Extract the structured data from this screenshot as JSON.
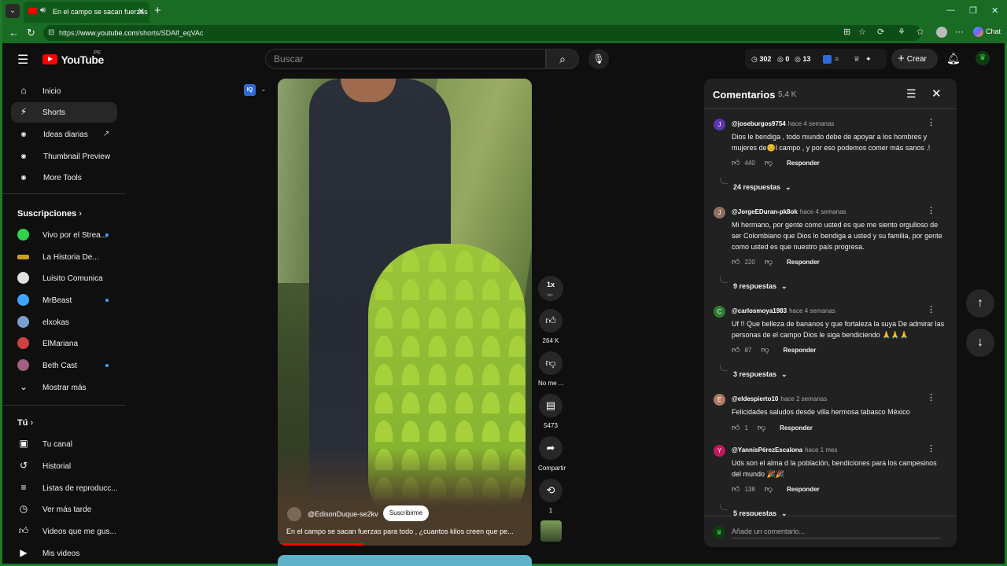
{
  "browser": {
    "tab_title": "En el campo se sacan fuerzas",
    "url_prefix": "https://",
    "url_host": "www.youtube.com",
    "url_path": "/shorts/SDAlf_eqVAc",
    "chat_label": "Chat"
  },
  "header": {
    "logo_text": "YouTube",
    "country_code": "PE",
    "search_placeholder": "Buscar",
    "stats": {
      "views": "302",
      "likes": "0",
      "comments": "13"
    },
    "create_label": "Crear"
  },
  "sidebar": {
    "main": [
      {
        "label": "Inicio",
        "icon": "home-icon"
      },
      {
        "label": "Shorts",
        "icon": "shorts-icon",
        "active": true
      },
      {
        "label": "Ideas diarias",
        "icon": "iq-icon"
      },
      {
        "label": "Thumbnail Preview",
        "icon": "iq-icon"
      },
      {
        "label": "More Tools",
        "icon": "iq-icon"
      }
    ],
    "subscriptions_title": "Suscripciones",
    "subscriptions": [
      {
        "label": "Vivo por el Strea...",
        "color": "#2fd14d",
        "dot": true
      },
      {
        "label": "La Historia De...",
        "color": "#c8a020",
        "dot": false
      },
      {
        "label": "Luisito Comunica",
        "color": "#e0e0e0",
        "dot": false
      },
      {
        "label": "MrBeast",
        "color": "#3ea6ff",
        "dot": true
      },
      {
        "label": "elxokas",
        "color": "#7aa0d0",
        "dot": false
      },
      {
        "label": "ElMariana",
        "color": "#d04040",
        "dot": false
      },
      {
        "label": "Beth Cast",
        "color": "#a06080",
        "dot": true
      }
    ],
    "show_more": "Mostrar más",
    "you_title": "Tú",
    "you": [
      {
        "label": "Tu canal",
        "icon": "channel-icon"
      },
      {
        "label": "Historial",
        "icon": "history-icon"
      },
      {
        "label": "Listas de reproducc...",
        "icon": "playlist-icon"
      },
      {
        "label": "Ver más tarde",
        "icon": "watch-later-icon"
      },
      {
        "label": "Videos que me gus...",
        "icon": "like-icon"
      },
      {
        "label": "Mis videos",
        "icon": "my-videos-icon"
      }
    ]
  },
  "short": {
    "channel": "@EdisonDuque-se2kv",
    "subscribe": "Suscribirme",
    "caption": "En el campo se sacan fuerzas para todo , ¿cuantos kilos creen que pe...",
    "speed": "1x",
    "likes": "264 K",
    "dislike_label": "No me ...",
    "comments": "5473",
    "share": "Compartir",
    "remix": "1"
  },
  "comments_panel": {
    "title": "Comentarios",
    "count": "5,4 K",
    "add_placeholder": "Añade un comentario...",
    "reply_label": "Responder",
    "items": [
      {
        "initial": "J",
        "color": "#5e35b1",
        "author": "@joseburgos9754",
        "time": "hace 4 semanas",
        "text": "Dios le bendiga , todo mundo debe de apoyar a los hombres y mujeres de😊l campo , y por eso podemos comer más sanos .!",
        "likes": "440",
        "replies": "24 respuestas"
      },
      {
        "initial": "J",
        "color": "#8d6e63",
        "author": "@JorgeEDuran-pk8ok",
        "time": "hace 4 semanas",
        "text": "Mi hermano, por gente como usted es que me siento orgulloso de ser Colombiano que Dios lo bendiga a usted y su familia, por gente como usted es que nuestro país progresa.",
        "likes": "220",
        "replies": "9 respuestas"
      },
      {
        "initial": "C",
        "color": "#2e7d32",
        "author": "@carlosmoya1983",
        "time": "hace 4 semanas",
        "text": "Uf !! Que belleza de bananos y que fortaleza la suya De admirar las personas de el campo Dios le siga bendiciendo 🙏🙏🙏",
        "likes": "87",
        "replies": "3 respuestas"
      },
      {
        "initial": "E",
        "color": "#b07a60",
        "author": "@eldespierto10",
        "time": "hace 2 semanas",
        "text": "Felicidades saludos desde villa hermosa tabasco México",
        "likes": "1",
        "replies": ""
      },
      {
        "initial": "Y",
        "color": "#c2185b",
        "author": "@YannisPérezEscalona",
        "time": "hace 1 mes",
        "text": "Uds son el alma d la población, bendiciones para los campesinos del mundo 🎉🎉",
        "likes": "138",
        "replies": "5 respuestas"
      }
    ]
  }
}
